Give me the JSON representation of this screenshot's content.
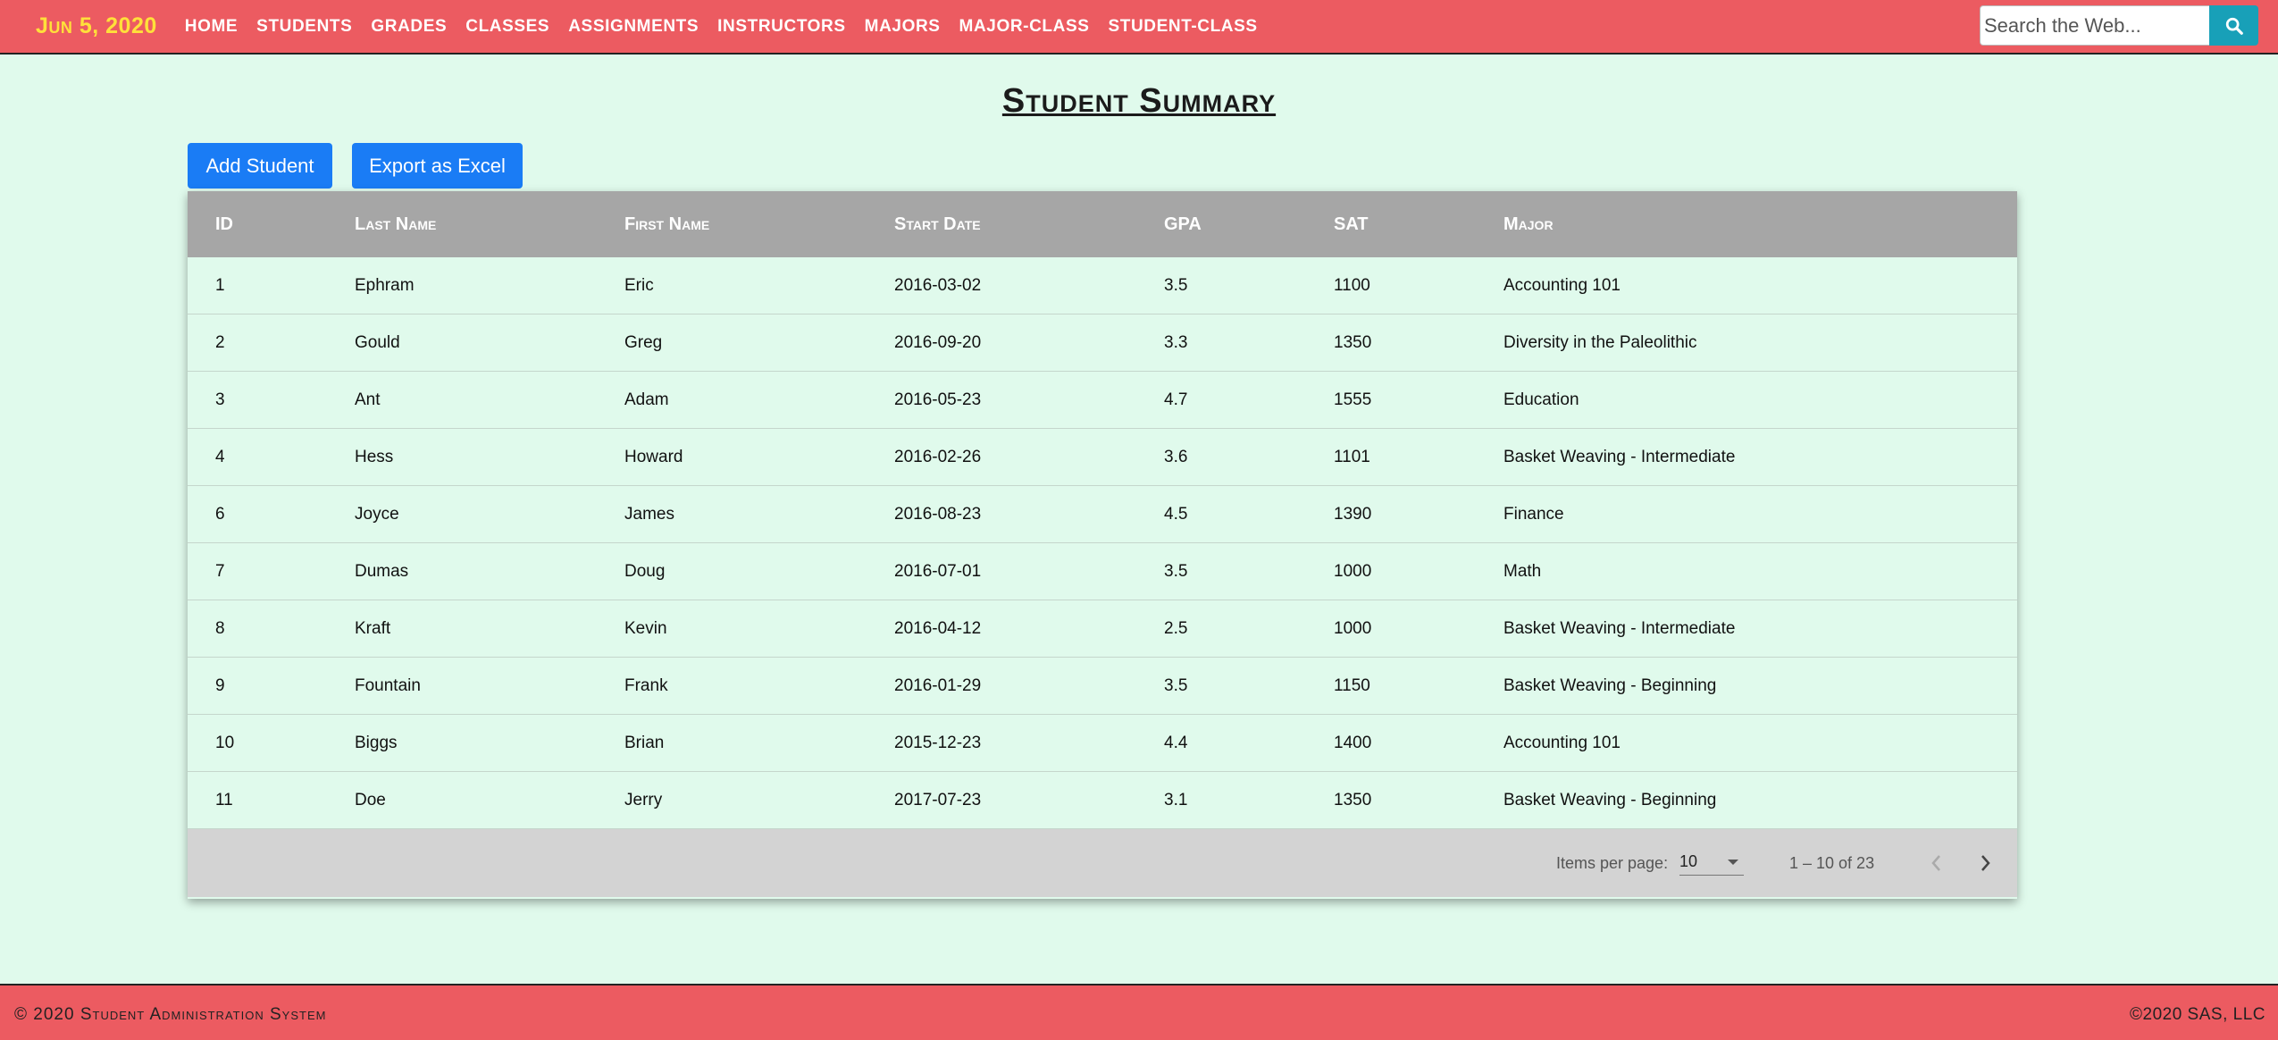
{
  "nav": {
    "date": "Jun 5, 2020",
    "links": [
      "Home",
      "Students",
      "Grades",
      "Classes",
      "Assignments",
      "Instructors",
      "Majors",
      "Major-Class",
      "Student-Class"
    ],
    "search_placeholder": "Search the Web...",
    "search_icon": "search-icon"
  },
  "page": {
    "title": "Student Summary",
    "add_button": "Add Student",
    "export_button": "Export as Excel"
  },
  "table": {
    "headers": {
      "id": "ID",
      "last": "Last Name",
      "first": "First Name",
      "start": "Start Date",
      "gpa": "GPA",
      "sat": "SAT",
      "major": "Major"
    },
    "rows": [
      {
        "id": "1",
        "last": "Ephram",
        "first": "Eric",
        "start": "2016-03-02",
        "gpa": "3.5",
        "sat": "1100",
        "major": "Accounting 101"
      },
      {
        "id": "2",
        "last": "Gould",
        "first": "Greg",
        "start": "2016-09-20",
        "gpa": "3.3",
        "sat": "1350",
        "major": "Diversity in the Paleolithic"
      },
      {
        "id": "3",
        "last": "Ant",
        "first": "Adam",
        "start": "2016-05-23",
        "gpa": "4.7",
        "sat": "1555",
        "major": "Education"
      },
      {
        "id": "4",
        "last": "Hess",
        "first": "Howard",
        "start": "2016-02-26",
        "gpa": "3.6",
        "sat": "1101",
        "major": "Basket Weaving - Intermediate"
      },
      {
        "id": "6",
        "last": "Joyce",
        "first": "James",
        "start": "2016-08-23",
        "gpa": "4.5",
        "sat": "1390",
        "major": "Finance"
      },
      {
        "id": "7",
        "last": "Dumas",
        "first": "Doug",
        "start": "2016-07-01",
        "gpa": "3.5",
        "sat": "1000",
        "major": "Math"
      },
      {
        "id": "8",
        "last": "Kraft",
        "first": "Kevin",
        "start": "2016-04-12",
        "gpa": "2.5",
        "sat": "1000",
        "major": "Basket Weaving - Intermediate"
      },
      {
        "id": "9",
        "last": "Fountain",
        "first": "Frank",
        "start": "2016-01-29",
        "gpa": "3.5",
        "sat": "1150",
        "major": "Basket Weaving - Beginning"
      },
      {
        "id": "10",
        "last": "Biggs",
        "first": "Brian",
        "start": "2015-12-23",
        "gpa": "4.4",
        "sat": "1400",
        "major": "Accounting 101"
      },
      {
        "id": "11",
        "last": "Doe",
        "first": "Jerry",
        "start": "2017-07-23",
        "gpa": "3.1",
        "sat": "1350",
        "major": "Basket Weaving - Beginning"
      }
    ]
  },
  "paginator": {
    "items_label": "Items per page:",
    "page_size": "10",
    "range": "1 – 10 of 23"
  },
  "footer": {
    "left": "© 2020 Student Administration System",
    "right": "©2020 SAS, LLC"
  },
  "colors": {
    "navbar": "#ec5b61",
    "background": "#e0faec",
    "date": "#ffe03a",
    "button": "#1a7cf5",
    "search_button": "#18a0b8",
    "table_header": "#a6a6a6"
  }
}
